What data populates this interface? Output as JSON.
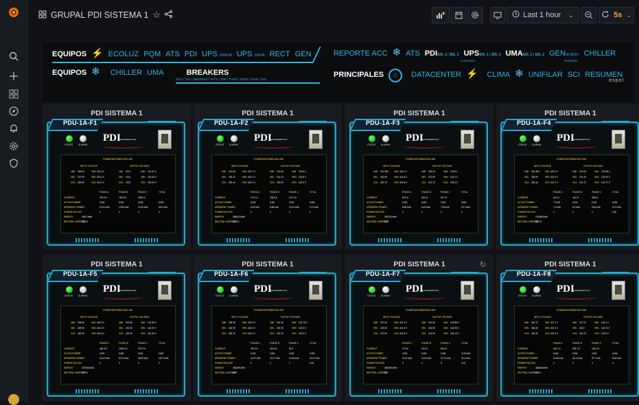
{
  "header": {
    "title": "GRUPAL PDI SISTEMA 1",
    "time_range": "Last 1 hour",
    "refresh_interval": "5s"
  },
  "nav": {
    "row1_left": {
      "heading": "EQUIPOS",
      "links": [
        "ECOLUZ",
        "PQM",
        "ATS",
        "PDI"
      ],
      "ups1": "UPS",
      "ups1_sub": "200KVA",
      "ups2": "UPS",
      "ups2_sub": "10KVA",
      "rect": "RECT",
      "gen": "GEN"
    },
    "row1_right": {
      "reporte": "REPORTE ACC",
      "ats": "ATS",
      "pdi": "PDI",
      "pdi_sub": "SIS. 1 / SIS. 2",
      "ups": "UPS",
      "ups_sub": "SIS. 1 / SIS. 2",
      "uma": "UMA",
      "uma_sub": "SIS. 1 / SIS. 2",
      "gen": "GEN",
      "gen_sub": "SCADA /",
      "chiller": "CHILLER",
      "canales": "CANALES",
      "niveles": "NIVELES"
    },
    "row2_left": {
      "heading": "EQUIPOS",
      "chiller": "CHILLER",
      "uma": "UMA",
      "breakers": "BREAKERS",
      "breakers_sub": "PSG / TDA / DEEPSEA / TATS / TDP / TUPS / TPDU / TCHI / TSG"
    },
    "row2_right": {
      "heading": "PRINCIPALES",
      "datacenter": "DATACENTER",
      "clima": "CLIMA",
      "unifilar": "UNIFILAR",
      "sci": "SCI",
      "resumen": "RESUMEN"
    },
    "brand": "espol"
  },
  "pdu_labels": {
    "status": "STATUS",
    "alarm": "ALARMA",
    "logo": "PDI",
    "tagline": "analog/digital amp",
    "data_title": "POWER DISTRIBUTION UNIT",
    "input_voltage": "INPUT VOLTAGE",
    "output_voltage": "OUTPUT VOLTAGE",
    "phase_a": "PHASE A",
    "phase_b": "PHASE B",
    "phase_c": "PHASE C",
    "total": "TOTAL",
    "current": "CURRENT",
    "active_power": "ACTIVE POWER",
    "apparent_power": "APPARENT POWER",
    "power_factor": "POWER FACTOR",
    "energy": "ENERGY",
    "neutral_current": "NEUTRAL CURRENT",
    "ab": "VAB",
    "bc": "VBC",
    "ca": "VCA",
    "an": "VAN",
    "bn": "VBN",
    "cn": "VCN"
  },
  "panels": [
    {
      "title": "PDI SISTEMA 1",
      "name": "PDU-1A-F1",
      "in": [
        "226.0V",
        "227.9V",
        "226.5V"
      ],
      "in_b": [
        "414.6 V",
        "415.2 V",
        "414.9 V"
      ],
      "out": [
        "207V",
        "214V",
        "213V"
      ],
      "out_b": [
        "124.57 V",
        "123.62 V",
        "125.10 V"
      ],
      "ph_a": [
        "233.4 A",
        "0 kW",
        "22.10 kVA",
        "0"
      ],
      "ph_b": [
        "152.6 A",
        "0 kW",
        "13.60 kVA",
        "0"
      ],
      "ph_c": [
        "196.6 A",
        "0 kW",
        "21.05 kVA",
        "0"
      ],
      "total": [
        "",
        "0 kW",
        "46.2 kVA",
        "0"
      ],
      "energy": "248.4 kWh",
      "neutral": "78.0 A"
    },
    {
      "title": "PDI SISTEMA 1",
      "name": "PDU-1A-F2",
      "in": [
        "241.8V",
        "240.1V",
        "240.4V"
      ],
      "in_b": [
        "415.7 V",
        "416.1 V",
        "416.2 V"
      ],
      "out": [
        "213.5V",
        "214.1V",
        "215.0V"
      ],
      "out_b": [
        "124.8 V",
        "123.8 V",
        "124.5 V"
      ],
      "ph_a": [
        "172.4 A",
        "0 kW",
        "8.20 kVA",
        "0"
      ],
      "ph_b": [
        "158.6 A",
        "0 kW",
        "8.38 kVA",
        "0"
      ],
      "ph_c": [
        "127.4 A",
        "0 kW",
        "10.10 kVA",
        "0"
      ],
      "total": [
        "",
        "0 kW",
        "27.9 kVA",
        "0"
      ],
      "energy": "465810 kWh",
      "neutral": "23.4 A"
    },
    {
      "title": "PDI SISTEMA 1",
      "name": "PDU-1A-F3",
      "in": [
        "241.35V",
        "230.5V",
        "232.7V"
      ],
      "in_b": [
        "416.2 V",
        "414.8 V",
        "415.8 V"
      ],
      "out": [
        "215.2V",
        "213.9V",
        "213.7V"
      ],
      "out_b": [
        "124.8 V",
        "124.3 V",
        "125.6 V"
      ],
      "ph_a": [
        "64.0 A",
        "0 kW",
        "8.65 kVA",
        "0"
      ],
      "ph_b": [
        "84.6 A",
        "0 kW",
        "8.22 kVA",
        "0"
      ],
      "ph_c": [
        "92.7 A",
        "0 kW",
        "7.93 kVA",
        "0"
      ],
      "total": [
        "",
        "0 kW",
        "22.7 kVA",
        "0"
      ],
      "energy": "434752 kWh",
      "neutral": "22.9"
    },
    {
      "title": "PDI SISTEMA 1",
      "name": "PDU-1A-F4",
      "in": [
        "240.45V",
        "228.9V",
        "230.4V"
      ],
      "in_b": [
        "415.4 V",
        "413.9 V",
        "413.7 V"
      ],
      "out": [
        "215.0V",
        "214.4V",
        "214.7V"
      ],
      "out_b": [
        "124.59 V",
        "124.94 V",
        "124.71 V"
      ],
      "ph_a": [
        "44.0 A",
        "7.9 kW",
        "7.9 kVA",
        "1"
      ],
      "ph_b": [
        "44.0 A",
        "0 kW",
        "8.2 kVA",
        "0"
      ],
      "ph_c": [
        "48.8 A",
        "0 kW",
        "8.32 kVA",
        "0"
      ],
      "total": [
        "",
        "0 kW",
        "21.3 kVA",
        "0.32"
      ],
      "energy": "123386 kWh",
      "neutral": "28.7 A"
    },
    {
      "title": "PDI SISTEMA 1",
      "name": "PDU-1A-F5",
      "in": [
        "239.9V",
        "228.5V",
        "240.9V"
      ],
      "in_b": [
        "415.9 V",
        "413.2 V",
        "413.8 V"
      ],
      "out": [
        "213.8V",
        "215.2V",
        "215.4V"
      ],
      "out_b": [
        "124.69 V",
        "124.37 V",
        "124.45 V"
      ],
      "ph_a": [
        "494.3 A",
        "0 kW",
        "32.23 kVA",
        "0"
      ],
      "ph_b": [
        "1493.2 A",
        "0 kW",
        "60.13 kVA",
        "0"
      ],
      "ph_c": [
        "372.9 A",
        "0 kW",
        "49.89 kVA",
        "0"
      ],
      "total": [
        "",
        "0 kW",
        "142.3 kVA",
        "0"
      ],
      "energy": "237946 kWh",
      "neutral": "73.3 A"
    },
    {
      "title": "PDI SISTEMA 1",
      "name": "PDU-1A-F6",
      "in": [
        "235.9V",
        "232.5V",
        "228.7V"
      ],
      "in_b": [
        "414.9 V",
        "415.2 V",
        "413.2 V"
      ],
      "out": [
        "214.3V",
        "215.3V",
        "215.7V"
      ],
      "out_b": [
        "122.79 V",
        "123.9 V",
        "124.5 V"
      ],
      "ph_a": [
        "422.0 A",
        "0 kW",
        "14.47 kVA",
        "0"
      ],
      "ph_b": [
        "441.9 A",
        "0 kW",
        "14.47 kVA",
        "0"
      ],
      "ph_c": [
        "82.0",
        "0 kW",
        "10.08 kVA",
        "1"
      ],
      "total": [
        "",
        "0 kW",
        "14.47 kVA",
        "0.23"
      ],
      "energy": "282489 kWh",
      "neutral": "40.4"
    },
    {
      "title": "PDI SISTEMA 1",
      "name": "PDU-1A-F7",
      "in": [
        "227.0V",
        "225.6V",
        "227.0V"
      ],
      "in_b": [
        "412.4 V",
        "414.9 V",
        "413.8 V"
      ],
      "out": [
        "214.5V",
        "215.9V",
        "214.9V"
      ],
      "out_b": [
        "123.88 V",
        "124.39 V",
        "125.13 V"
      ],
      "ph_a": [
        "37.0 A",
        "0 kW",
        "11.57 kVA",
        "0"
      ],
      "ph_b": [
        "33.4 A",
        "0 kW",
        "11.62 kVA",
        "0"
      ],
      "ph_c": [
        "84.9 A",
        "0 kW",
        "10.73 kVA",
        "0"
      ],
      "total": [
        "",
        "11.92 kW",
        "24.4 kVA",
        "0.23"
      ],
      "energy": "466255 kWh",
      "neutral": "0.4"
    },
    {
      "title": "PDI SISTEMA 1",
      "name": "PDU-1A-F8",
      "in": [
        "240.7V",
        "236.8V",
        "240.4V"
      ],
      "in_b": [
        "417.1 V",
        "413.9 V",
        "415.3 V"
      ],
      "out": [
        "217.2V",
        "216V",
        "215.7V"
      ],
      "out_b": [
        "124.4 V",
        "124.74 V",
        "124.9 V"
      ],
      "ph_a": [
        "402.1 A",
        "0 kW",
        "32.46 kVA",
        "0"
      ],
      "ph_b": [
        "402.1 A",
        "0 kW",
        "33.14 kVA",
        "0"
      ],
      "ph_c": [
        "140.2 A",
        "0 kW",
        "37.7 kVA",
        "0"
      ],
      "total": [
        "",
        "0 kW",
        "93.6 kVA",
        "0"
      ],
      "energy": "484828 kWh",
      "neutral": "121.4"
    }
  ]
}
